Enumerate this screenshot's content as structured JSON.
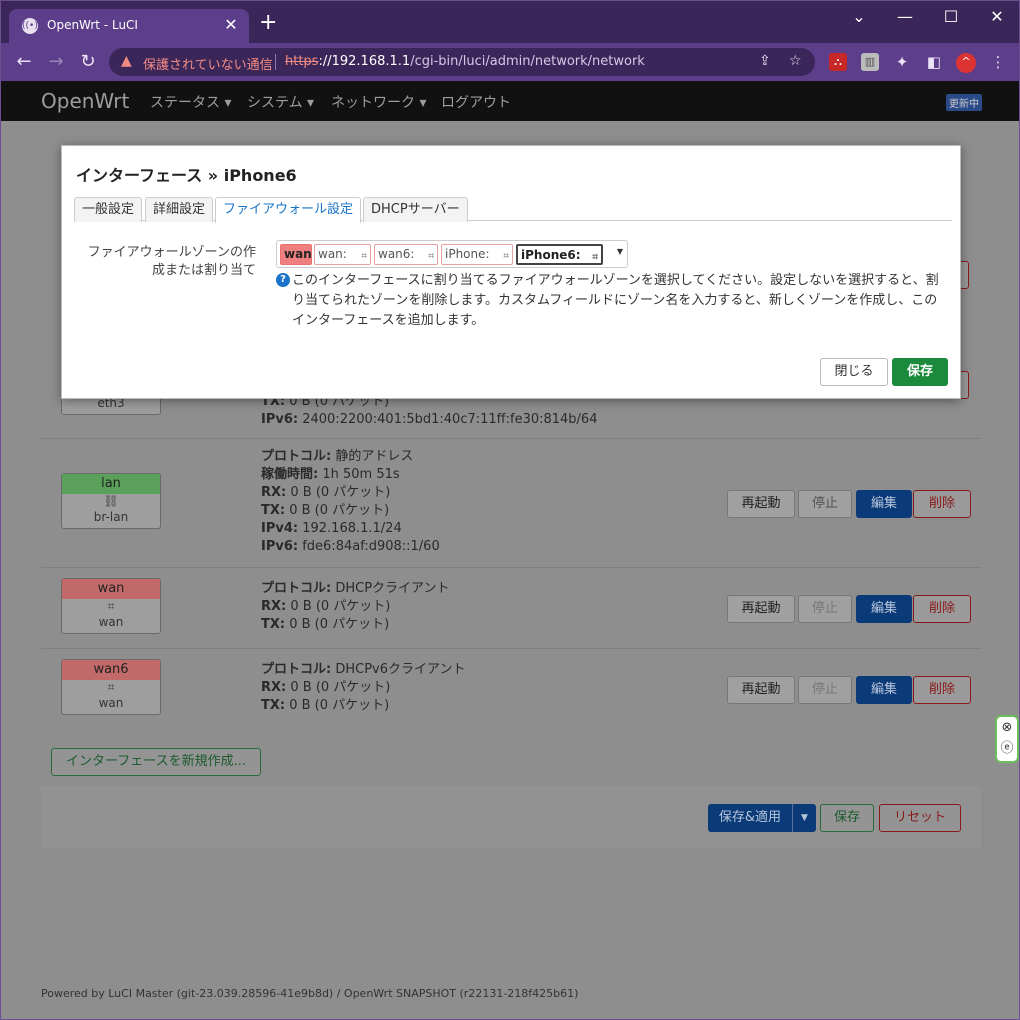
{
  "browser": {
    "tab_title": "OpenWrt - LuCI",
    "new_tab_symbol": "+",
    "security_warning": "保護されていない通信",
    "url_scheme": "https",
    "url_host": "://192.168.1.1",
    "url_path": "/cgi-bin/luci/admin/network/network"
  },
  "navbar": {
    "brand": "OpenWrt",
    "menu": [
      "ステータス ▾",
      "システム ▾",
      "ネットワーク ▾",
      "ログアウト"
    ],
    "refresh_badge": "更新中"
  },
  "interfaces": [
    {
      "name": "",
      "device": "eth3",
      "color": "#9e9e9e",
      "lines": [
        {
          "k": "TX:",
          "v": " 0 B (0 パケット)"
        },
        {
          "k": "IPv6:",
          "v": " 2400:2200:401:5bd1:40c7:11ff:fe30:814b/64"
        }
      ]
    },
    {
      "name": "lan",
      "device": "br-lan",
      "color": "#5aa05a",
      "lines": [
        {
          "k": "プロトコル:",
          "v": " 静的アドレス"
        },
        {
          "k": "稼働時間:",
          "v": " 1h 50m 51s"
        },
        {
          "k": "RX:",
          "v": " 0 B (0 パケット)"
        },
        {
          "k": "TX:",
          "v": " 0 B (0 パケット)"
        },
        {
          "k": "IPv4:",
          "v": " 192.168.1.1/24"
        },
        {
          "k": "IPv6:",
          "v": " fde6:84af:d908::1/60"
        }
      ]
    },
    {
      "name": "wan",
      "device": "wan",
      "color": "#c26a6a",
      "lines": [
        {
          "k": "プロトコル:",
          "v": " DHCPクライアント"
        },
        {
          "k": "RX:",
          "v": " 0 B (0 パケット)"
        },
        {
          "k": "TX:",
          "v": " 0 B (0 パケット)"
        }
      ]
    },
    {
      "name": "wan6",
      "device": "wan",
      "color": "#c26a6a",
      "lines": [
        {
          "k": "プロトコル:",
          "v": " DHCPv6クライアント"
        },
        {
          "k": "RX:",
          "v": " 0 B (0 パケット)"
        },
        {
          "k": "TX:",
          "v": " 0 B (0 パケット)"
        }
      ]
    }
  ],
  "row_buttons": {
    "restart": "再起動",
    "stop": "停止",
    "edit": "編集",
    "delete": "削除"
  },
  "add_interface": "インターフェースを新規作成...",
  "footer_buttons": {
    "save_apply": "保存&適用",
    "save": "保存",
    "reset": "リセット"
  },
  "powered_by": "Powered by LuCI Master (git-23.039.28596-41e9b8d) / OpenWrt SNAPSHOT (r22131-218f425b61)",
  "modal": {
    "title": "インターフェース » iPhone6",
    "tabs": [
      "一般設定",
      "詳細設定",
      "ファイアウォール設定",
      "DHCPサーバー"
    ],
    "active_tab": "ファイアウォール設定",
    "field_label": "ファイアウォールゾーンの作成または割り当て",
    "zones": {
      "selected": "wan",
      "chips": [
        "wan:",
        "wan6:",
        "iPhone:",
        "iPhone6:"
      ]
    },
    "help": "このインターフェースに割り当てるファイアウォールゾーンを選択してください。設定しないを選択すると、割り当てられたゾーンを削除します。カスタムフィールドにゾーン名を入力すると、新しくゾーンを作成し、このインターフェースを追加します。",
    "close": "閉じる",
    "save": "保存"
  }
}
